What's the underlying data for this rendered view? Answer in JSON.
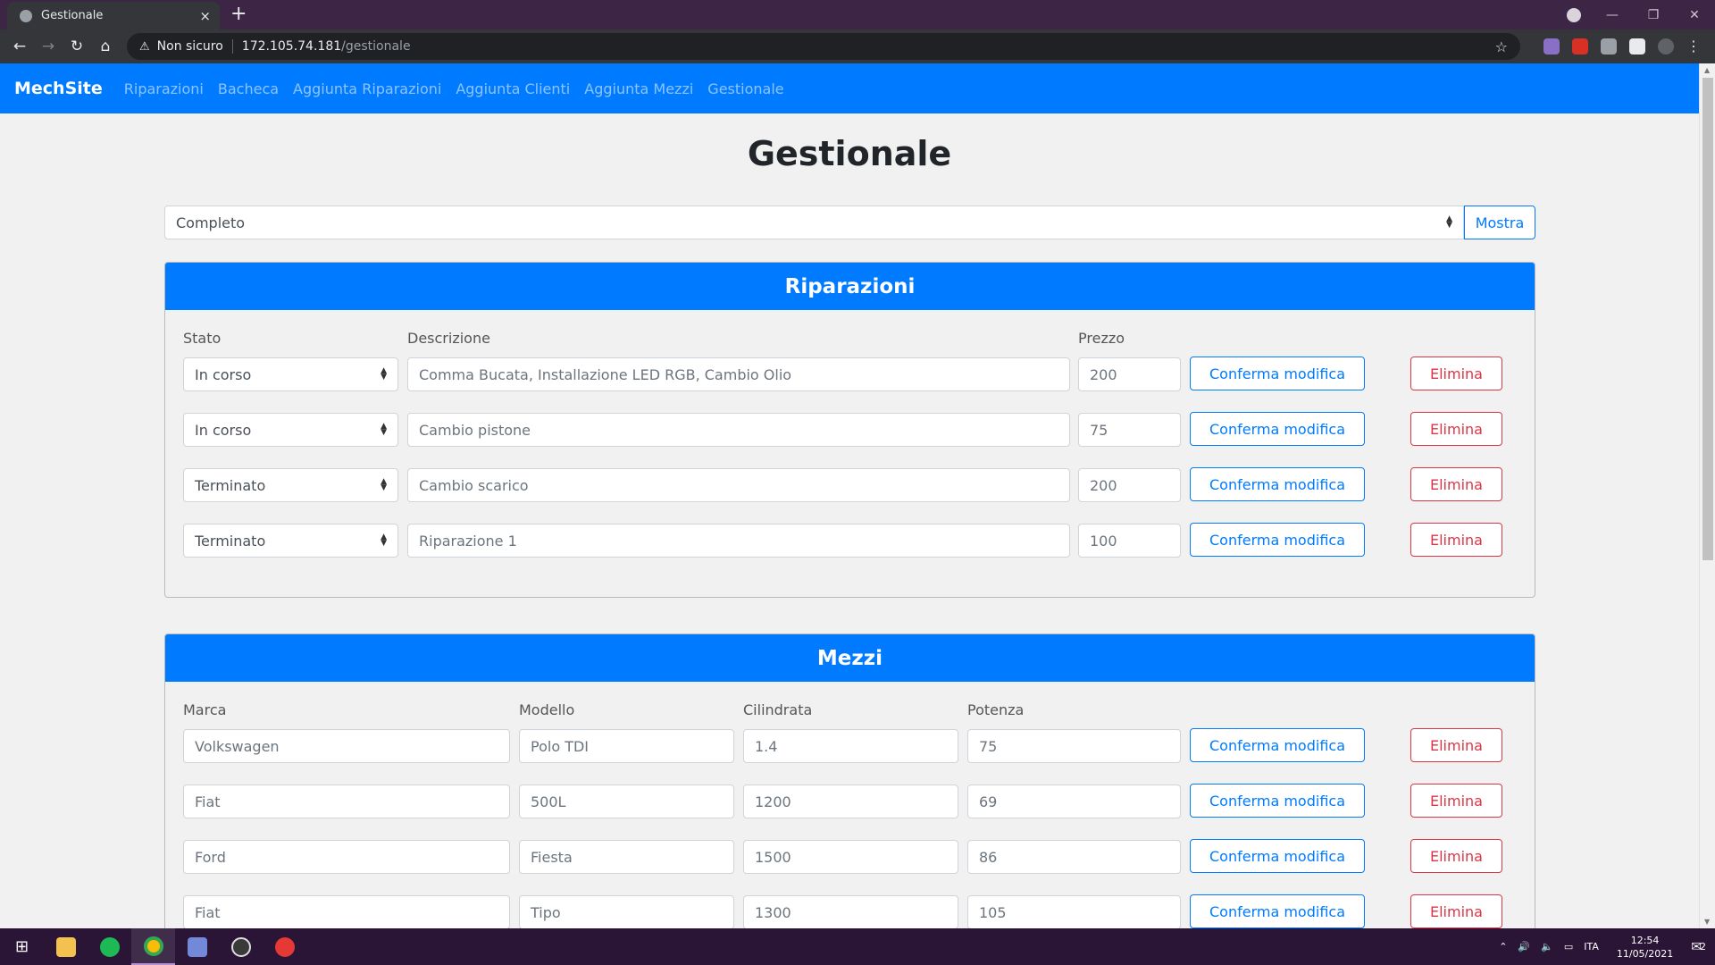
{
  "browser": {
    "tab_title": "Gestionale",
    "tab_close": "×",
    "new_tab": "+",
    "security_label": "Non sicuro",
    "url_host": "172.105.74.181",
    "url_path": "/gestionale"
  },
  "navbar": {
    "brand": "MechSite",
    "links": [
      "Riparazioni",
      "Bacheca",
      "Aggiunta Riparazioni",
      "Aggiunta Clienti",
      "Aggiunta Mezzi",
      "Gestionale"
    ]
  },
  "page": {
    "title": "Gestionale",
    "filter_value": "Completo",
    "show_button": "Mostra"
  },
  "riparazioni": {
    "header": "Riparazioni",
    "columns": {
      "stato": "Stato",
      "descrizione": "Descrizione",
      "prezzo": "Prezzo"
    },
    "rows": [
      {
        "stato": "In corso",
        "descrizione": "Comma Bucata, Installazione LED RGB, Cambio Olio",
        "prezzo": "200"
      },
      {
        "stato": "In corso",
        "descrizione": "Cambio pistone",
        "prezzo": "75"
      },
      {
        "stato": "Terminato",
        "descrizione": "Cambio scarico",
        "prezzo": "200"
      },
      {
        "stato": "Terminato",
        "descrizione": "Riparazione 1",
        "prezzo": "100"
      }
    ]
  },
  "mezzi": {
    "header": "Mezzi",
    "columns": {
      "marca": "Marca",
      "modello": "Modello",
      "cilindrata": "Cilindrata",
      "potenza": "Potenza"
    },
    "rows": [
      {
        "marca": "Volkswagen",
        "modello": "Polo TDI",
        "cilindrata": "1.4",
        "potenza": "75"
      },
      {
        "marca": "Fiat",
        "modello": "500L",
        "cilindrata": "1200",
        "potenza": "69"
      },
      {
        "marca": "Ford",
        "modello": "Fiesta",
        "cilindrata": "1500",
        "potenza": "86"
      },
      {
        "marca": "Fiat",
        "modello": "Tipo",
        "cilindrata": "1300",
        "potenza": "105"
      }
    ]
  },
  "buttons": {
    "confirm": "Conferma modifica",
    "delete": "Elimina"
  },
  "taskbar": {
    "language": "ITA",
    "time": "12:54",
    "date": "11/05/2021",
    "notifications": "2"
  },
  "colors": {
    "primary": "#007bff",
    "danger": "#dc3545",
    "page_bg": "#f1f1f1",
    "taskbar": "#2b1537"
  }
}
